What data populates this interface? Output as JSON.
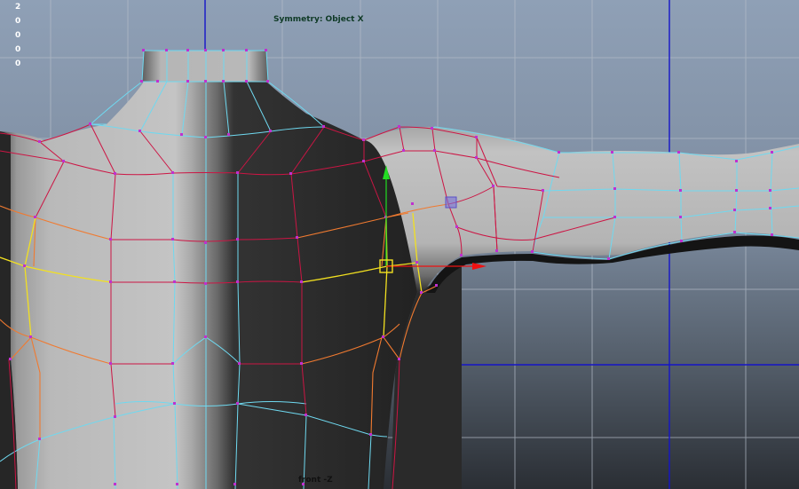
{
  "hud": {
    "symmetry_label": "Symmetry: Object X",
    "camera_label": "front -Z",
    "counts": [
      "2",
      "0",
      "0",
      "0",
      "0"
    ]
  },
  "colors": {
    "wire_cyan": "#6fd9f0",
    "wire_red": "#cc1544",
    "wire_orange": "#f07a30",
    "wire_yellow": "#f2e020",
    "vertex_magenta": "#c030d0",
    "manip_y": "#22dd22",
    "manip_x": "#ee1111",
    "grid_axis": "#1414c8",
    "grid_line": "#b4bcc8"
  },
  "icons": {
    "move_manipulator": "move-manipulator-icon",
    "manip_center": "manip-center-square-icon",
    "plane_handle": "plane-handle-icon"
  }
}
